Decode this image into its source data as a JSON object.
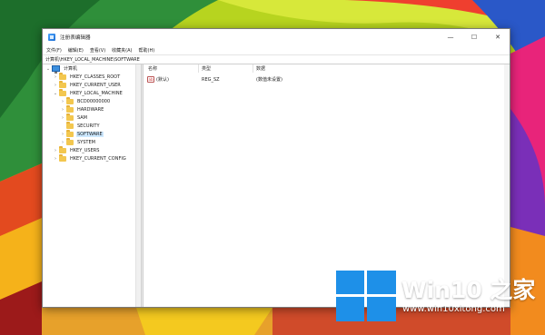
{
  "window": {
    "title": "注册表编辑器",
    "controls": {
      "minimize": "—",
      "maximize": "☐",
      "close": "✕"
    },
    "menu": [
      "文件(F)",
      "编辑(E)",
      "查看(V)",
      "收藏夹(A)",
      "帮助(H)"
    ],
    "address": "计算机\\HKEY_LOCAL_MACHINE\\SOFTWARE"
  },
  "tree": {
    "root": "计算机",
    "items": [
      {
        "label": "HKEY_CLASSES_ROOT",
        "chevron": "›",
        "icon": "folder-icon"
      },
      {
        "label": "HKEY_CURRENT_USER",
        "chevron": "›",
        "icon": "folder-icon"
      },
      {
        "label": "HKEY_LOCAL_MACHINE",
        "chevron": "⌄",
        "icon": "folder-icon"
      },
      {
        "label": "BCD00000000",
        "chevron": "›",
        "icon": "folder-icon"
      },
      {
        "label": "HARDWARE",
        "chevron": "›",
        "icon": "folder-icon"
      },
      {
        "label": "SAM",
        "chevron": "›",
        "icon": "folder-icon"
      },
      {
        "label": "SECURITY",
        "chevron": "",
        "icon": "folder-icon"
      },
      {
        "label": "SOFTWARE",
        "chevron": "›",
        "icon": "folder-icon",
        "selected": true
      },
      {
        "label": "SYSTEM",
        "chevron": "›",
        "icon": "folder-icon"
      },
      {
        "label": "HKEY_USERS",
        "chevron": "›",
        "icon": "folder-icon"
      },
      {
        "label": "HKEY_CURRENT_CONFIG",
        "chevron": "›",
        "icon": "folder-icon"
      }
    ]
  },
  "list": {
    "columns": [
      "名称",
      "类型",
      "数据"
    ],
    "rows": [
      {
        "name": "(默认)",
        "type": "REG_SZ",
        "data": "(数值未设置)",
        "icon_text": "ab"
      }
    ]
  },
  "watermark": {
    "brand_text": "Win10 之家",
    "site": "www.win10xitong.com",
    "logo_color": "#1e90e8"
  }
}
